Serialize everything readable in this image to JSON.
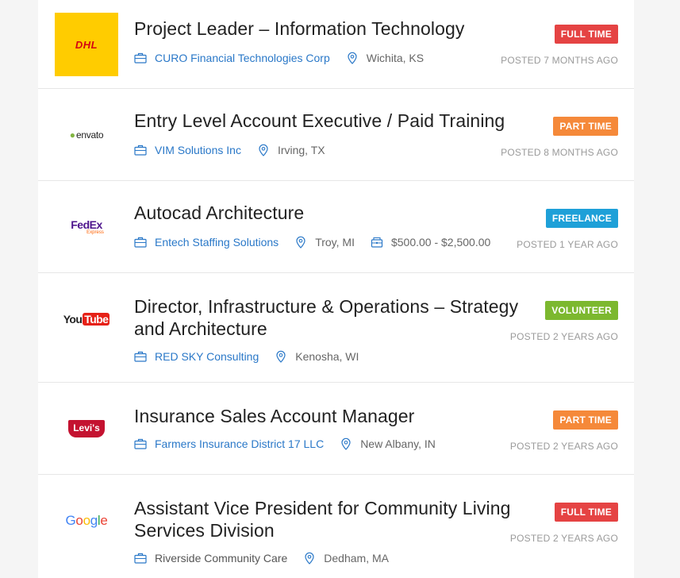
{
  "jobs": [
    {
      "logo": "DHL",
      "logo_bg": "#ffcc00",
      "logo_color": "#d40511",
      "title": "Project Leader – Information Technology",
      "company": "CURO Financial Technologies Corp",
      "location": "Wichita, KS",
      "salary": "",
      "type": "FULL TIME",
      "type_color": "#e54343",
      "posted": "POSTED 7 MONTHS AGO"
    },
    {
      "logo": "envato",
      "logo_bg": "#ffffff",
      "logo_color": "#222222",
      "title": "Entry Level Account Executive / Paid Training",
      "company": "VIM Solutions Inc",
      "location": "Irving, TX",
      "salary": "",
      "type": "PART TIME",
      "type_color": "#f5893a",
      "posted": "POSTED 8 MONTHS AGO"
    },
    {
      "logo": "FedEx",
      "logo_sub": "Express",
      "logo_bg": "#ffffff",
      "logo_color": "#4d148c",
      "logo_color2": "#ff6200",
      "title": "Autocad Architecture",
      "company": "Entech Staffing Solutions",
      "location": "Troy, MI",
      "salary": "$500.00 - $2,500.00",
      "type": "FREELANCE",
      "type_color": "#1ea0d8",
      "posted": "POSTED 1 YEAR AGO"
    },
    {
      "logo": "You",
      "logo2": "Tube",
      "logo_bg": "#ffffff",
      "logo_color": "#222222",
      "logo_color2": "#e62117",
      "title": "Director, Infrastructure & Operations – Strategy and Architecture",
      "company": "RED SKY Consulting",
      "location": "Kenosha, WI",
      "salary": "",
      "type": "VOLUNTEER",
      "type_color": "#7cb82f",
      "posted": "POSTED 2 YEARS AGO"
    },
    {
      "logo": "Levi's",
      "logo_bg": "#ffffff",
      "logo_color": "#c41230",
      "title": "Insurance Sales Account Manager",
      "company": "Farmers Insurance District 17 LLC",
      "location": "New Albany, IN",
      "salary": "",
      "type": "PART TIME",
      "type_color": "#f5893a",
      "posted": "POSTED 2 YEARS AGO"
    },
    {
      "logo": "Google",
      "logo_bg": "#ffffff",
      "logo_color": "#4285f4",
      "title": "Assistant Vice President for Community Living Services Division",
      "company": "Riverside Community Care",
      "location": "Dedham, MA",
      "salary": "",
      "type": "FULL TIME",
      "type_color": "#e54343",
      "posted": "POSTED 2 YEARS AGO"
    }
  ]
}
